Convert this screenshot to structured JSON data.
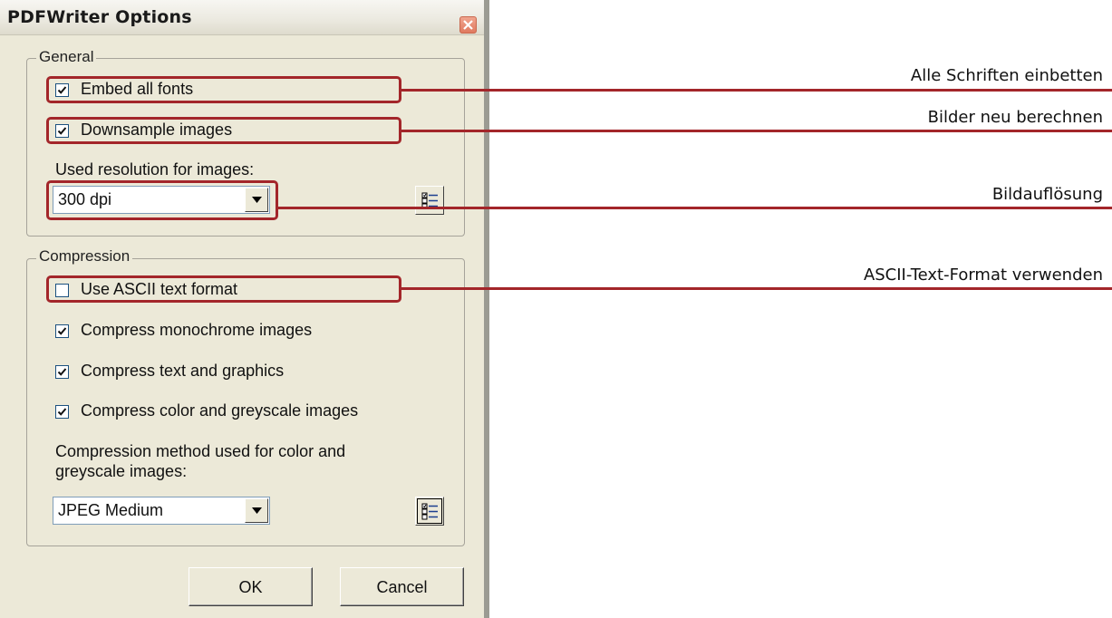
{
  "dialog": {
    "title": "PDFWriter Options",
    "general": {
      "legend": "General",
      "embed_fonts": {
        "label": "Embed all fonts",
        "checked": true
      },
      "downsample": {
        "label": "Downsample images",
        "checked": true
      },
      "resolution_label": "Used resolution for images:",
      "resolution_value": "300 dpi"
    },
    "compression": {
      "legend": "Compression",
      "ascii": {
        "label": "Use ASCII text format",
        "checked": false
      },
      "mono": {
        "label": "Compress monochrome images",
        "checked": true
      },
      "text_graphics": {
        "label": "Compress text and graphics",
        "checked": true
      },
      "color_grey": {
        "label": "Compress color and greyscale images",
        "checked": true
      },
      "method_label": "Compression method used for color and greyscale images:",
      "method_value": "JPEG Medium"
    },
    "buttons": {
      "ok": "OK",
      "cancel": "Cancel"
    }
  },
  "annotations": {
    "embed_fonts": "Alle Schriften einbetten",
    "downsample": "Bilder neu berechnen",
    "resolution": "Bildauflösung",
    "ascii": "ASCII-Text-Format verwenden"
  },
  "colors": {
    "annotation": "#a3262a",
    "dialog_bg": "#ece9d8"
  }
}
